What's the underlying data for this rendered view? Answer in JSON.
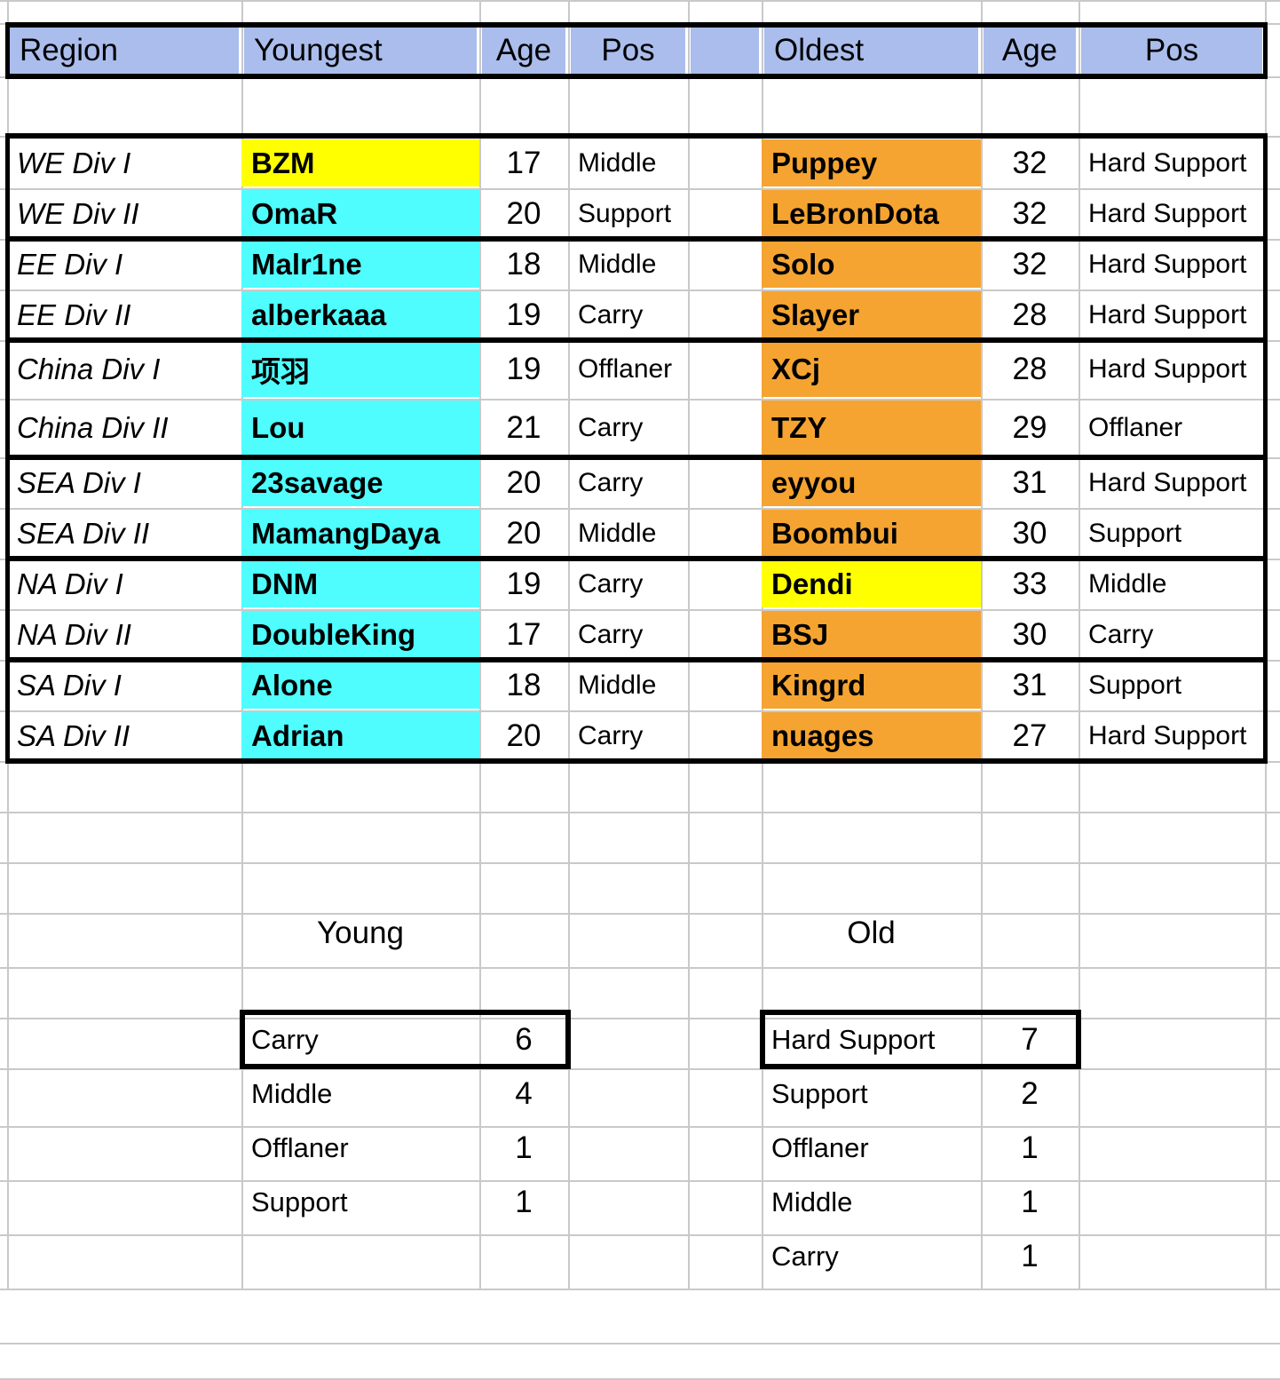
{
  "table": {
    "headers": {
      "region": "Region",
      "youngest": "Youngest",
      "age_young": "Age",
      "pos_young": "Pos",
      "spacer": "",
      "oldest": "Oldest",
      "age_old": "Age",
      "pos_old": "Pos"
    },
    "rows": [
      {
        "region": "WE Div I",
        "young_name": "BZM",
        "young_fill": "yellow",
        "young_age": "17",
        "young_pos": "Middle",
        "old_name": "Puppey",
        "old_fill": "orange",
        "old_age": "32",
        "old_pos": "Hard Support"
      },
      {
        "region": "WE Div II",
        "young_name": "OmaR",
        "young_fill": "cyan",
        "young_age": "20",
        "young_pos": "Support",
        "old_name": "LeBronDota",
        "old_fill": "orange",
        "old_age": "32",
        "old_pos": "Hard Support"
      },
      {
        "region": "EE Div I",
        "young_name": "Malr1ne",
        "young_fill": "cyan",
        "young_age": "18",
        "young_pos": "Middle",
        "old_name": "Solo",
        "old_fill": "orange",
        "old_age": "32",
        "old_pos": "Hard Support"
      },
      {
        "region": "EE Div II",
        "young_name": "alberkaaa",
        "young_fill": "cyan",
        "young_age": "19",
        "young_pos": "Carry",
        "old_name": "Slayer",
        "old_fill": "orange",
        "old_age": "28",
        "old_pos": "Hard Support"
      },
      {
        "region": "China Div I",
        "young_name": "项羽",
        "young_fill": "cyan",
        "young_age": "19",
        "young_pos": "Offlaner",
        "old_name": "XCj",
        "old_fill": "orange",
        "old_age": "28",
        "old_pos": "Hard Support"
      },
      {
        "region": "China Div II",
        "young_name": "Lou",
        "young_fill": "cyan",
        "young_age": "21",
        "young_pos": "Carry",
        "old_name": "TZY",
        "old_fill": "orange",
        "old_age": "29",
        "old_pos": "Offlaner"
      },
      {
        "region": "SEA Div I",
        "young_name": "23savage",
        "young_fill": "cyan",
        "young_age": "20",
        "young_pos": "Carry",
        "old_name": "eyyou",
        "old_fill": "orange",
        "old_age": "31",
        "old_pos": "Hard Support"
      },
      {
        "region": "SEA Div II",
        "young_name": "MamangDaya",
        "young_fill": "cyan",
        "young_age": "20",
        "young_pos": "Middle",
        "old_name": "Boombui",
        "old_fill": "orange",
        "old_age": "30",
        "old_pos": "Support"
      },
      {
        "region": "NA Div I",
        "young_name": "DNM",
        "young_fill": "cyan",
        "young_age": "19",
        "young_pos": "Carry",
        "old_name": "Dendi",
        "old_fill": "yellow",
        "old_age": "33",
        "old_pos": "Middle"
      },
      {
        "region": "NA Div II",
        "young_name": "DoubleKing",
        "young_fill": "cyan",
        "young_age": "17",
        "young_pos": "Carry",
        "old_name": "BSJ",
        "old_fill": "orange",
        "old_age": "30",
        "old_pos": "Carry"
      },
      {
        "region": "SA Div I",
        "young_name": "Alone",
        "young_fill": "cyan",
        "young_age": "18",
        "young_pos": "Middle",
        "old_name": "Kingrd",
        "old_fill": "orange",
        "old_age": "31",
        "old_pos": "Support"
      },
      {
        "region": "SA Div II",
        "young_name": "Adrian",
        "young_fill": "cyan",
        "young_age": "20",
        "young_pos": "Carry",
        "old_name": "nuages",
        "old_fill": "orange",
        "old_age": "27",
        "old_pos": "Hard Support"
      }
    ]
  },
  "summary": {
    "young": {
      "title": "Young",
      "rows": [
        {
          "label": "Carry",
          "value": "6"
        },
        {
          "label": "Middle",
          "value": "4"
        },
        {
          "label": "Offlaner",
          "value": "1"
        },
        {
          "label": "Support",
          "value": "1"
        }
      ]
    },
    "old": {
      "title": "Old",
      "rows": [
        {
          "label": "Hard Support",
          "value": "7"
        },
        {
          "label": "Support",
          "value": "2"
        },
        {
          "label": "Offlaner",
          "value": "1"
        },
        {
          "label": "Middle",
          "value": "1"
        },
        {
          "label": "Carry",
          "value": "1"
        }
      ]
    }
  },
  "colors": {
    "header_fill": "#aabdec",
    "highlight_yellow": "#ffff00",
    "highlight_cyan": "#4ffdff",
    "highlight_orange": "#f5a431",
    "gridline": "#c9c9c9",
    "border": "#000000"
  }
}
